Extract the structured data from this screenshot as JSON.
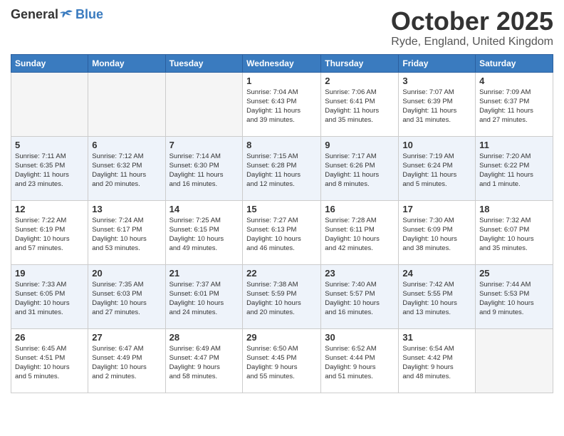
{
  "logo": {
    "general": "General",
    "blue": "Blue"
  },
  "header": {
    "month": "October 2025",
    "location": "Ryde, England, United Kingdom"
  },
  "weekdays": [
    "Sunday",
    "Monday",
    "Tuesday",
    "Wednesday",
    "Thursday",
    "Friday",
    "Saturday"
  ],
  "weeks": [
    [
      {
        "day": "",
        "info": ""
      },
      {
        "day": "",
        "info": ""
      },
      {
        "day": "",
        "info": ""
      },
      {
        "day": "1",
        "info": "Sunrise: 7:04 AM\nSunset: 6:43 PM\nDaylight: 11 hours\nand 39 minutes."
      },
      {
        "day": "2",
        "info": "Sunrise: 7:06 AM\nSunset: 6:41 PM\nDaylight: 11 hours\nand 35 minutes."
      },
      {
        "day": "3",
        "info": "Sunrise: 7:07 AM\nSunset: 6:39 PM\nDaylight: 11 hours\nand 31 minutes."
      },
      {
        "day": "4",
        "info": "Sunrise: 7:09 AM\nSunset: 6:37 PM\nDaylight: 11 hours\nand 27 minutes."
      }
    ],
    [
      {
        "day": "5",
        "info": "Sunrise: 7:11 AM\nSunset: 6:35 PM\nDaylight: 11 hours\nand 23 minutes."
      },
      {
        "day": "6",
        "info": "Sunrise: 7:12 AM\nSunset: 6:32 PM\nDaylight: 11 hours\nand 20 minutes."
      },
      {
        "day": "7",
        "info": "Sunrise: 7:14 AM\nSunset: 6:30 PM\nDaylight: 11 hours\nand 16 minutes."
      },
      {
        "day": "8",
        "info": "Sunrise: 7:15 AM\nSunset: 6:28 PM\nDaylight: 11 hours\nand 12 minutes."
      },
      {
        "day": "9",
        "info": "Sunrise: 7:17 AM\nSunset: 6:26 PM\nDaylight: 11 hours\nand 8 minutes."
      },
      {
        "day": "10",
        "info": "Sunrise: 7:19 AM\nSunset: 6:24 PM\nDaylight: 11 hours\nand 5 minutes."
      },
      {
        "day": "11",
        "info": "Sunrise: 7:20 AM\nSunset: 6:22 PM\nDaylight: 11 hours\nand 1 minute."
      }
    ],
    [
      {
        "day": "12",
        "info": "Sunrise: 7:22 AM\nSunset: 6:19 PM\nDaylight: 10 hours\nand 57 minutes."
      },
      {
        "day": "13",
        "info": "Sunrise: 7:24 AM\nSunset: 6:17 PM\nDaylight: 10 hours\nand 53 minutes."
      },
      {
        "day": "14",
        "info": "Sunrise: 7:25 AM\nSunset: 6:15 PM\nDaylight: 10 hours\nand 49 minutes."
      },
      {
        "day": "15",
        "info": "Sunrise: 7:27 AM\nSunset: 6:13 PM\nDaylight: 10 hours\nand 46 minutes."
      },
      {
        "day": "16",
        "info": "Sunrise: 7:28 AM\nSunset: 6:11 PM\nDaylight: 10 hours\nand 42 minutes."
      },
      {
        "day": "17",
        "info": "Sunrise: 7:30 AM\nSunset: 6:09 PM\nDaylight: 10 hours\nand 38 minutes."
      },
      {
        "day": "18",
        "info": "Sunrise: 7:32 AM\nSunset: 6:07 PM\nDaylight: 10 hours\nand 35 minutes."
      }
    ],
    [
      {
        "day": "19",
        "info": "Sunrise: 7:33 AM\nSunset: 6:05 PM\nDaylight: 10 hours\nand 31 minutes."
      },
      {
        "day": "20",
        "info": "Sunrise: 7:35 AM\nSunset: 6:03 PM\nDaylight: 10 hours\nand 27 minutes."
      },
      {
        "day": "21",
        "info": "Sunrise: 7:37 AM\nSunset: 6:01 PM\nDaylight: 10 hours\nand 24 minutes."
      },
      {
        "day": "22",
        "info": "Sunrise: 7:38 AM\nSunset: 5:59 PM\nDaylight: 10 hours\nand 20 minutes."
      },
      {
        "day": "23",
        "info": "Sunrise: 7:40 AM\nSunset: 5:57 PM\nDaylight: 10 hours\nand 16 minutes."
      },
      {
        "day": "24",
        "info": "Sunrise: 7:42 AM\nSunset: 5:55 PM\nDaylight: 10 hours\nand 13 minutes."
      },
      {
        "day": "25",
        "info": "Sunrise: 7:44 AM\nSunset: 5:53 PM\nDaylight: 10 hours\nand 9 minutes."
      }
    ],
    [
      {
        "day": "26",
        "info": "Sunrise: 6:45 AM\nSunset: 4:51 PM\nDaylight: 10 hours\nand 5 minutes."
      },
      {
        "day": "27",
        "info": "Sunrise: 6:47 AM\nSunset: 4:49 PM\nDaylight: 10 hours\nand 2 minutes."
      },
      {
        "day": "28",
        "info": "Sunrise: 6:49 AM\nSunset: 4:47 PM\nDaylight: 9 hours\nand 58 minutes."
      },
      {
        "day": "29",
        "info": "Sunrise: 6:50 AM\nSunset: 4:45 PM\nDaylight: 9 hours\nand 55 minutes."
      },
      {
        "day": "30",
        "info": "Sunrise: 6:52 AM\nSunset: 4:44 PM\nDaylight: 9 hours\nand 51 minutes."
      },
      {
        "day": "31",
        "info": "Sunrise: 6:54 AM\nSunset: 4:42 PM\nDaylight: 9 hours\nand 48 minutes."
      },
      {
        "day": "",
        "info": ""
      }
    ]
  ]
}
